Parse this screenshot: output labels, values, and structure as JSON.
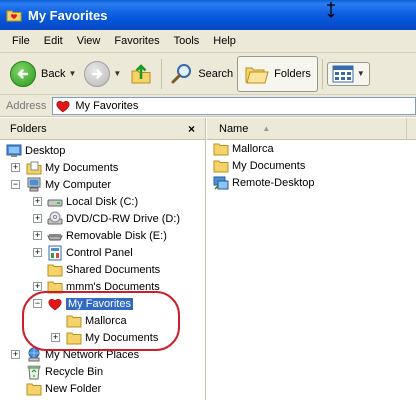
{
  "window": {
    "title": "My Favorites"
  },
  "menu": [
    "File",
    "Edit",
    "View",
    "Favorites",
    "Tools",
    "Help"
  ],
  "toolbar": {
    "back_label": "Back",
    "search_label": "Search",
    "folders_label": "Folders"
  },
  "address": {
    "label": "Address",
    "value": "My Favorites"
  },
  "folders_pane": {
    "header": "Folders",
    "close_glyph": "×",
    "items": [
      {
        "label": "Desktop"
      },
      {
        "label": "My Documents"
      },
      {
        "label": "My Computer"
      },
      {
        "label": "Local Disk (C:)"
      },
      {
        "label": "DVD/CD-RW Drive (D:)"
      },
      {
        "label": "Removable Disk (E:)"
      },
      {
        "label": "Control Panel"
      },
      {
        "label": "Shared Documents"
      },
      {
        "label": "mmm's Documents"
      },
      {
        "label": "My Favorites",
        "selected": true
      },
      {
        "label": "Mallorca"
      },
      {
        "label": "My Documents"
      },
      {
        "label": "My Network Places"
      },
      {
        "label": "Recycle Bin"
      },
      {
        "label": "New Folder"
      }
    ]
  },
  "file_list": {
    "column_name": "Name",
    "items": [
      {
        "label": "Mallorca",
        "icon": "folder-icon"
      },
      {
        "label": "My Documents",
        "icon": "folder-icon"
      },
      {
        "label": "Remote-Desktop",
        "icon": "remote-desktop-icon"
      }
    ]
  },
  "colors": {
    "titlebar": "#0551d4",
    "selection": "#316ac5",
    "annotation": "#cc1f2a",
    "chrome": "#ece9d8"
  }
}
